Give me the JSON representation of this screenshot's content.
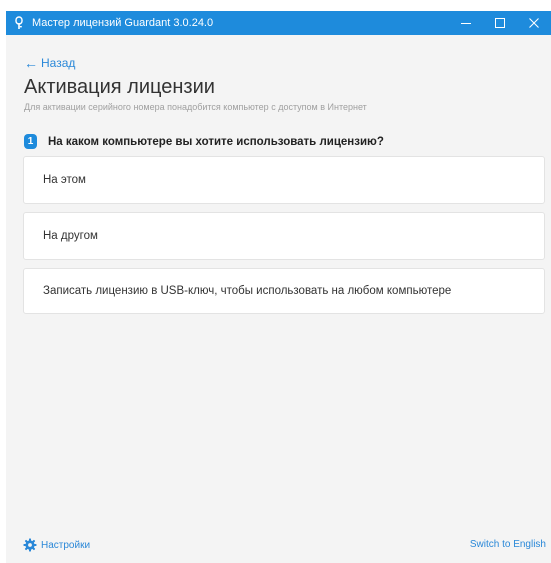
{
  "window": {
    "title": "Мастер лицензий Guardant 3.0.24.0",
    "accent_color": "#1e8bdc"
  },
  "nav": {
    "back_label": "Назад"
  },
  "page": {
    "title": "Активация лицензии",
    "subtitle": "Для активации серийного номера понадобится компьютер с доступом в Интернет"
  },
  "question": {
    "step": "1",
    "text": "На каком компьютере вы хотите использовать лицензию?"
  },
  "options": [
    {
      "label": "На этом"
    },
    {
      "label": "На другом"
    },
    {
      "label": "Записать лицензию в USB-ключ, чтобы использовать на любом компьютере"
    }
  ],
  "footer": {
    "settings_label": "Настройки",
    "language_label": "Switch to English",
    "link_color": "#2a88d8"
  },
  "icons": {
    "app": "license-key-icon",
    "back": "arrow-left-icon",
    "settings": "gear-icon",
    "minimize": "minimize-icon",
    "maximize": "maximize-icon",
    "close": "close-icon"
  }
}
